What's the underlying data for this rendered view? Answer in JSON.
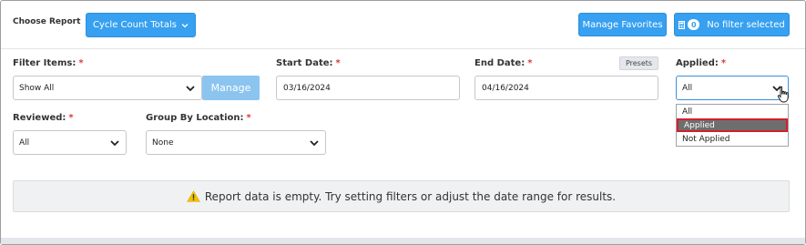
{
  "header": {
    "choose_report_label": "Choose Report",
    "report_dropdown_label": "Cycle Count Totals",
    "manage_favorites_label": "Manage Favorites",
    "filter_count": "0",
    "filter_status_label": "No filter selected"
  },
  "filters": {
    "filter_items": {
      "label": "Filter Items:",
      "required": "*",
      "value": "Show All",
      "manage_label": "Manage"
    },
    "start_date": {
      "label": "Start Date:",
      "required": "*",
      "value": "03/16/2024"
    },
    "end_date": {
      "label": "End Date:",
      "required": "*",
      "value": "04/16/2024",
      "presets_label": "Presets"
    },
    "applied": {
      "label": "Applied:",
      "required": "*",
      "value": "All",
      "options": [
        "All",
        "Applied",
        "Not Applied"
      ],
      "highlighted_option": "Applied"
    },
    "reviewed": {
      "label": "Reviewed:",
      "required": "*",
      "value": "All"
    },
    "group_by_location": {
      "label": "Group By Location:",
      "required": "*",
      "value": "None"
    }
  },
  "message": {
    "icon": "warning-icon",
    "text": "Report data is empty. Try setting filters or adjust the date range for results."
  },
  "colors": {
    "accent": "#37a0f0",
    "required": "#d63a3a",
    "warning": "#f2c200",
    "highlight_border": "#d41f2c"
  }
}
